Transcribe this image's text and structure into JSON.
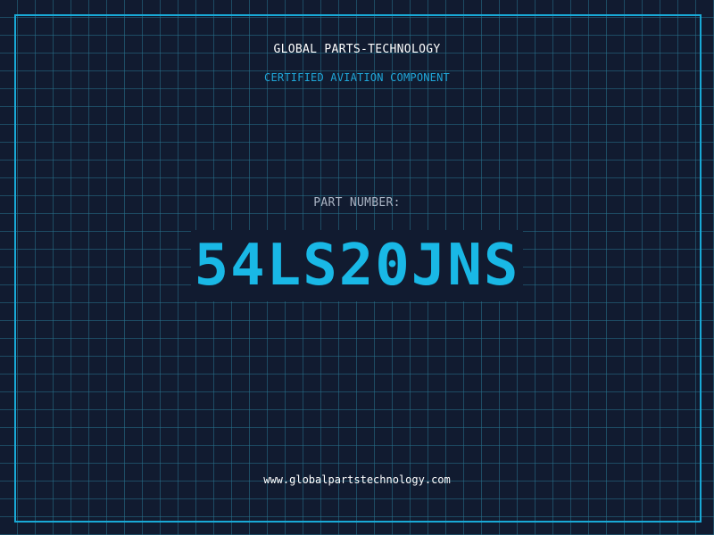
{
  "header": {
    "company": "GLOBAL PARTS-TECHNOLOGY",
    "subtitle": "CERTIFIED AVIATION COMPONENT"
  },
  "part": {
    "label": "PART NUMBER:",
    "number": "54LS20JNS"
  },
  "footer": {
    "website": "www.globalpartstechnology.com"
  },
  "colors": {
    "background": "#111b30",
    "grid": "#27738c",
    "accent": "#19a9d6",
    "part_number": "#19b8e6",
    "text": "#ffffff",
    "label": "#aab4c4"
  }
}
